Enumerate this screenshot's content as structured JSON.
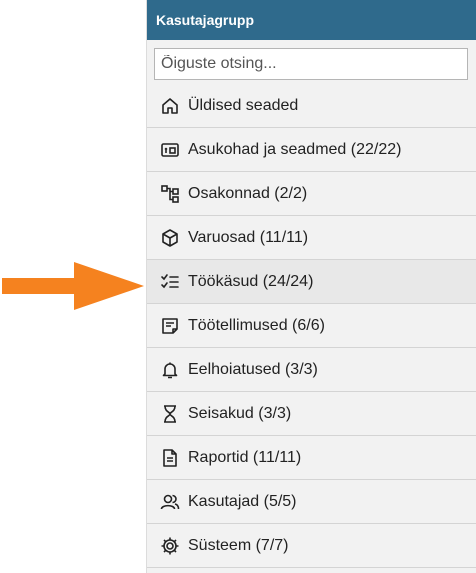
{
  "panel": {
    "title": "Kasutajagrupp",
    "search_placeholder": "Õiguste otsing...",
    "items": [
      {
        "label": "Üldised seaded",
        "icon": "home-icon"
      },
      {
        "label": "Asukohad ja seadmed (22/22)",
        "icon": "locations-icon"
      },
      {
        "label": "Osakonnad (2/2)",
        "icon": "hierarchy-icon"
      },
      {
        "label": "Varuosad (11/11)",
        "icon": "box-icon"
      },
      {
        "label": "Töökäsud (24/24)",
        "icon": "checklist-icon"
      },
      {
        "label": "Töötellimused (6/6)",
        "icon": "note-icon"
      },
      {
        "label": "Eelhoiatused (3/3)",
        "icon": "bell-icon"
      },
      {
        "label": "Seisakud (3/3)",
        "icon": "hourglass-icon"
      },
      {
        "label": "Raportid (11/11)",
        "icon": "document-icon"
      },
      {
        "label": "Kasutajad (5/5)",
        "icon": "users-icon"
      },
      {
        "label": "Süsteem (7/7)",
        "icon": "gear-icon"
      }
    ]
  },
  "colors": {
    "header_bg": "#2f6a8c",
    "arrow": "#f5821f",
    "panel_bg": "#f2f2f2"
  },
  "annotation": {
    "icon": "pointer-arrow-icon",
    "points_to": "Töökäsud (24/24)"
  }
}
